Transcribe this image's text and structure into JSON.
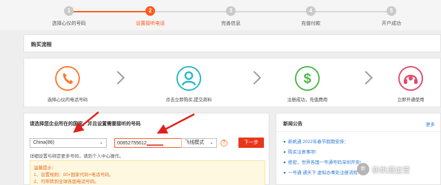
{
  "steps": [
    {
      "num": "1",
      "label": "选择心仪的号码"
    },
    {
      "num": "2",
      "label": "设置接听电话"
    },
    {
      "num": "3",
      "label": "完善信息"
    },
    {
      "num": "4",
      "label": "充值付款"
    },
    {
      "num": "5",
      "label": "开户成功"
    }
  ],
  "flow": {
    "title": "购买流程",
    "items": [
      {
        "label": "选择心仪的电话号码",
        "icon": "phone-icon",
        "color": "#ff7a2e"
      },
      {
        "label": "点击立即购买,提交资料",
        "icon": "user-icon",
        "color": "#27b8c8"
      },
      {
        "label": "注册成功，充值费用",
        "icon": "dollar-icon",
        "color": "#4cb848"
      },
      {
        "label": "立即开通使用",
        "icon": "headset-icon",
        "color": "#e34a6a"
      }
    ]
  },
  "form": {
    "title": "请选择您企业所在的国家，并且设置需要接听的号码",
    "country_value": "China(86)",
    "phone_value": "00852755612",
    "mode_value": "飞线模式",
    "help_icon": "?",
    "next_label": "下一步",
    "detail_note": "详细设置与绑定更多号码，请到个人中心操作。",
    "tips_title": "温馨提示：",
    "tips": [
      "1、设置规则：00+国家代码+电话号码。",
      "2、可呼转到全球各国电话号码。"
    ]
  },
  "news": {
    "title": "新闻公告",
    "more": "更多",
    "items": [
      "新帆通 2022年春节假期安排：",
      "购买注意事项!",
      "绝密，世界各国一号通号码深圳开卖!",
      "一号通 通天下 虚拟办事处注册流程"
    ]
  },
  "watermark": {
    "badge": "新",
    "text": "新帆通运营"
  },
  "colors": {
    "accent": "#ff5a1f",
    "button": "#e9361b",
    "link": "#2f7bd6"
  }
}
